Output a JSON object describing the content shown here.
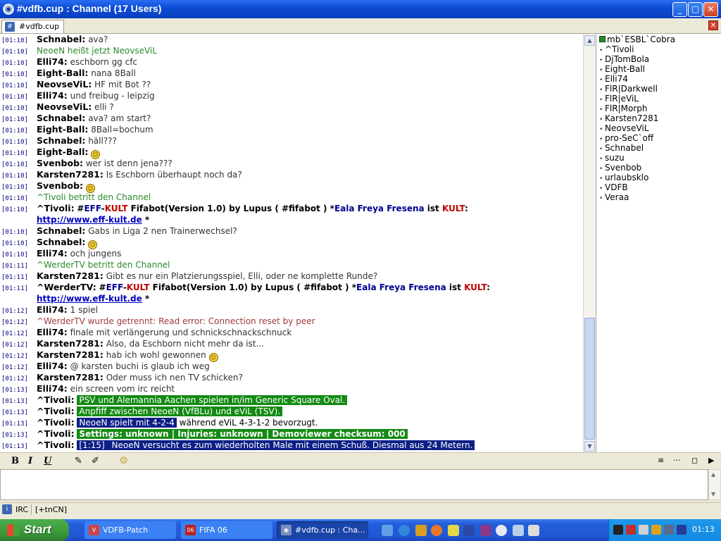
{
  "window": {
    "title": "#vdfb.cup : Channel (17 Users)",
    "buttons": {
      "minimize": "_",
      "maximize": "▢",
      "close": "✕"
    },
    "icon": "mirc-icon"
  },
  "tab": {
    "label": "#vdfb.cup",
    "icon": "channel-icon",
    "close": "✕"
  },
  "messages": [
    {
      "ts": "[01:10]",
      "nick": "Schnabel:",
      "text": "ava?"
    },
    {
      "ts": "[01:10]",
      "event": "NeoeN heißt jetzt NeovseViL"
    },
    {
      "ts": "[01:10]",
      "nick": "Elli74:",
      "text": "eschborn gg cfc"
    },
    {
      "ts": "[01:10]",
      "nick": "Eight-Ball:",
      "text": "nana 8Ball"
    },
    {
      "ts": "[01:10]",
      "nick": "NeovseViL:",
      "text": "HF mit Bot ??"
    },
    {
      "ts": "[01:10]",
      "nick": "Elli74:",
      "text": "und freibug - leipzig"
    },
    {
      "ts": "[01:10]",
      "nick": "NeovseViL:",
      "text": "elli ?"
    },
    {
      "ts": "[01:10]",
      "nick": "Schnabel:",
      "text": "ava? am start?"
    },
    {
      "ts": "[01:10]",
      "nick": "Eight-Ball:",
      "text": " 8Ball=bochum"
    },
    {
      "ts": "[01:10]",
      "nick": "Schnabel:",
      "text": "häll???"
    },
    {
      "ts": "[01:10]",
      "nick": "Eight-Ball:",
      "text": "",
      "smiley": true
    },
    {
      "ts": "[01:10]",
      "nick": "Svenbob:",
      "text": "wer ist denn jena???"
    },
    {
      "ts": "[01:10]",
      "nick": "Karsten7281:",
      "text": "Is Eschborn überhaupt noch da?"
    },
    {
      "ts": "[01:10]",
      "nick": "Svenbob:",
      "text": "",
      "smiley": true
    },
    {
      "ts": "[01:10]",
      "event": "^Tivoli betritt den Channel"
    }
  ],
  "bot_line_1": {
    "ts": "[01:10]",
    "nick": "^Tivoli:",
    "pre": "#",
    "eff": "EFF",
    "dash": "-",
    "kult": "KULT",
    "mid": " Fifabot(Version 1.0) by Lupus ( #fifabot ) *",
    "eala": "Eala Freya Fresena",
    "ist": " ist ",
    "kult2": "KULT",
    ":": ":",
    "link": "http://www.eff-kult.de",
    "star": " *"
  },
  "messages_2": [
    {
      "ts": "[01:10]",
      "nick": "Schnabel:",
      "text": "Gabs in Liga 2 nen Trainerwechsel?"
    },
    {
      "ts": "[01:10]",
      "nick": "Schnabel:",
      "text": "",
      "smiley": true
    },
    {
      "ts": "[01:10]",
      "nick": "Elli74:",
      "text": "och jungens"
    },
    {
      "ts": "[01:11]",
      "event": "^WerderTV betritt den Channel"
    },
    {
      "ts": "[01:11]",
      "nick": "Karsten7281:",
      "text": "Gibt es nur ein Platzierungsspiel, Elli, oder ne komplette Runde?"
    }
  ],
  "bot_line_2": {
    "ts": "[01:11]",
    "nick": "^WerderTV:",
    "pre": "#",
    "eff": "EFF",
    "dash": "-",
    "kult": "KULT",
    "mid": " Fifabot(Version 1.0) by Lupus ( #fifabot ) *",
    "eala": "Eala Freya Fresena",
    "ist": " ist ",
    "kult2": "KULT",
    "colon": ":",
    "link": "http://www.eff-kult.de",
    "star": " *"
  },
  "messages_3": [
    {
      "ts": "[01:12]",
      "nick": "Elli74:",
      "text": "1 spiel"
    },
    {
      "ts": "[01:12]",
      "quit": "^WerderTV wurde getrennt: Read error: Connection reset by peer"
    },
    {
      "ts": "[01:12]",
      "nick": "Elli74:",
      "text": "finale mit verlängerung und schnickschnackschnuck"
    },
    {
      "ts": "[01:12]",
      "nick": "Karsten7281:",
      "text": "Also, da Eschborn nicht mehr da ist..."
    },
    {
      "ts": "[01:12]",
      "nick": "Karsten7281:",
      "text": "hab ich wohl gewonnen",
      "smiley": true
    },
    {
      "ts": "[01:12]",
      "nick": "Elli74:",
      "text": "@ karsten buchi is glaub ich weg"
    },
    {
      "ts": "[01:12]",
      "nick": "Karsten7281:",
      "text": "Oder muss ich nen TV schicken?"
    },
    {
      "ts": "[01:13]",
      "nick": "Elli74:",
      "text": "ein screen vom irc reicht"
    }
  ],
  "game_lines": [
    {
      "ts": "[01:13]",
      "nick": "^Tivoli:",
      "a": "PSV und Alemannia Aachen spielen in/im Generic Square Oval."
    },
    {
      "ts": "[01:13]",
      "nick": "^Tivoli:",
      "a": "Anpfiff zwischen NeoeN (VfBLu) und eViL (TSV)."
    },
    {
      "ts": "[01:13]",
      "nick": "^Tivoli:",
      "a": "NeoeN spielt mit 4-2-4",
      "b": " während eViL 4-3-1-2 bevorzugt."
    },
    {
      "ts": "[01:13]",
      "nick": "^Tivoli:",
      "a": "Settings: unknown | Injuries: unknown | Demoviewer checksum: 000"
    },
    {
      "ts": "[01:13]",
      "nick": "^Tivoli:",
      "a": "[1:15]",
      "b": " NeoeN versucht es zum wiederholten Male mit einem Schuß. Diesmal aus 24 Metern."
    }
  ],
  "nicklist": [
    {
      "name": "mb`ESBL`Cobra",
      "op": true
    },
    {
      "name": "^Tivoli"
    },
    {
      "name": "DjTomBola"
    },
    {
      "name": "Eight-Ball"
    },
    {
      "name": "Elli74"
    },
    {
      "name": "FlR|Darkwell"
    },
    {
      "name": "FlR|eViL"
    },
    {
      "name": "FlR|Morph"
    },
    {
      "name": "Karsten7281"
    },
    {
      "name": "NeovseViL"
    },
    {
      "name": "pro-SeC`off"
    },
    {
      "name": "Schnabel"
    },
    {
      "name": "suzu"
    },
    {
      "name": "Svenbob"
    },
    {
      "name": "urlaubsklo"
    },
    {
      "name": "VDFB"
    },
    {
      "name": "Veraa"
    }
  ],
  "format_toolbar": {
    "bold": "B",
    "italic": "I",
    "underline": "U",
    "color": "✎",
    "bgcolor": "✐",
    "emoticon": "☺",
    "list": "≡",
    "more": "···",
    "box": "◻",
    "next": "▶"
  },
  "status": {
    "network": "IRC",
    "modes": "[+tnCN]"
  },
  "taskbar": {
    "start": "Start",
    "tasks": [
      {
        "label": "VDFB-Patch",
        "icon": "patch-icon"
      },
      {
        "label": "FIFA 06",
        "icon": "fifa-icon"
      },
      {
        "label": "#vdfb.cup : Cha...",
        "icon": "mirc-icon"
      }
    ],
    "clock": "01:13",
    "colors": {
      "taskbar": "#245edb",
      "start": "#3a9a3a",
      "tray": "#128ae0"
    }
  }
}
